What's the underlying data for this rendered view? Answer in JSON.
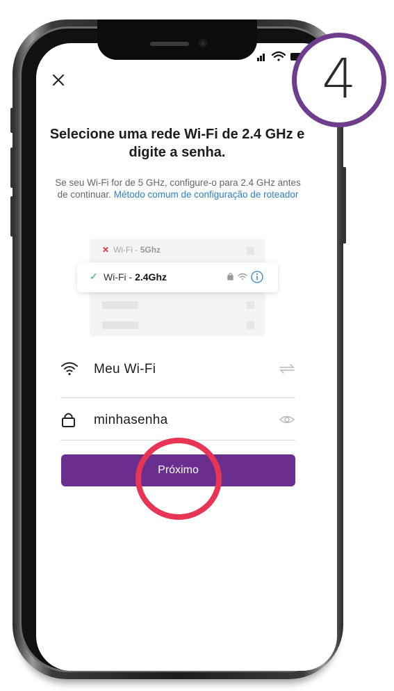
{
  "header": {
    "close_icon": "close-icon"
  },
  "content": {
    "title": "Selecione uma rede Wi-Fi de 2.4 GHz e digite a senha.",
    "subtitle_text": "Se seu Wi-Fi for de 5 GHz, configure-o para 2.4 GHz antes de continuar.",
    "subtitle_link": "Método comum de configuração de roteador"
  },
  "illustration": {
    "row1_prefix": "Wi-Fi - ",
    "row1_band": "5Ghz",
    "row2_prefix": "Wi-Fi - ",
    "row2_band": "2.4Ghz"
  },
  "form": {
    "ssid_value": "Meu Wi-Fi",
    "password_value": "minhasenha"
  },
  "actions": {
    "next_label": "Próximo"
  },
  "annotation": {
    "step_number": "4"
  },
  "colors": {
    "accent": "#6a2e8e",
    "link": "#2b82c9",
    "highlight": "#e83556",
    "badge_border": "#6e3d8e"
  }
}
